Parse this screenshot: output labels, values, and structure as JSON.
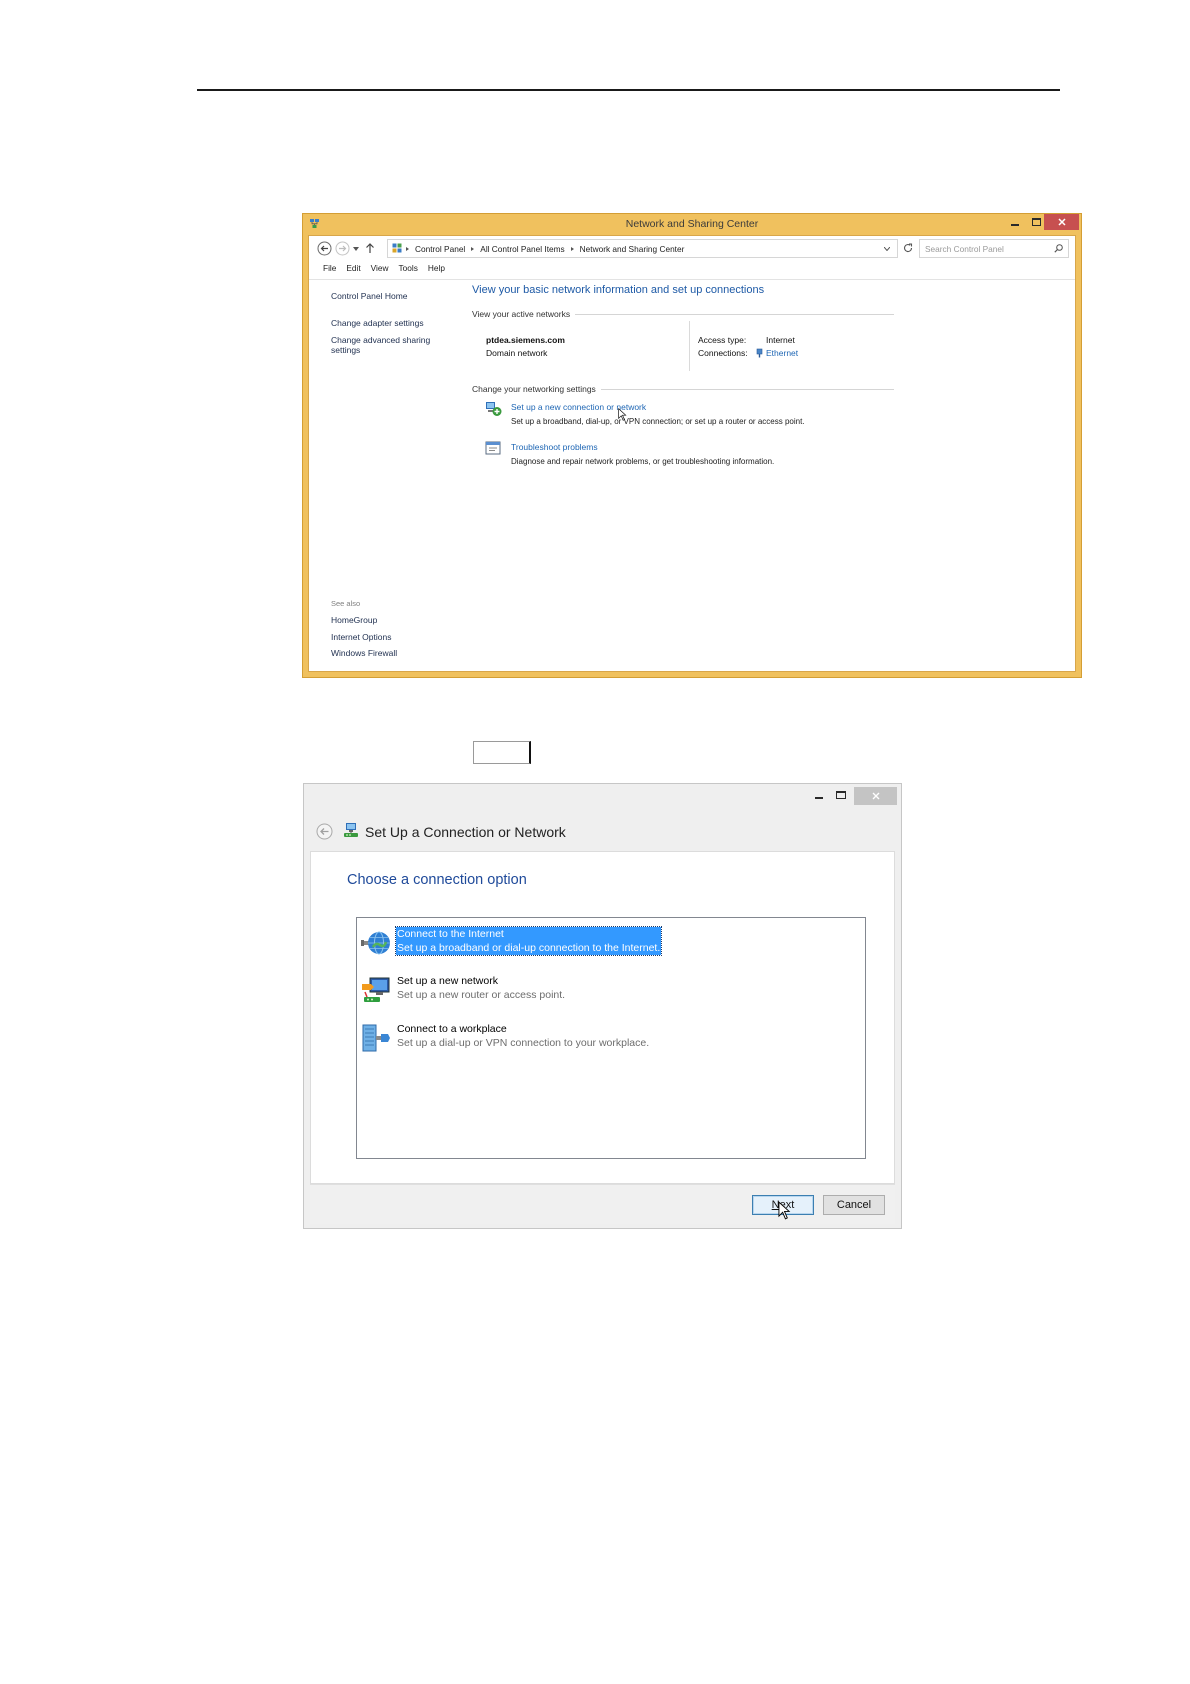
{
  "colors": {
    "window_frame": "#F0C15E",
    "close_button": "#C75050",
    "link": "#1E66B4",
    "heading": "#1E5AA6",
    "selection": "#3399FF",
    "dialog_heading": "#1F4A9A",
    "focus_border": "#3C7FB1"
  },
  "network_window": {
    "title": "Network and Sharing Center",
    "breadcrumb": [
      "Control Panel",
      "All Control Panel Items",
      "Network and Sharing Center"
    ],
    "search_placeholder": "Search Control Panel",
    "menu": [
      "File",
      "Edit",
      "View",
      "Tools",
      "Help"
    ],
    "left_pane": {
      "links": [
        "Control Panel Home",
        "Change adapter settings",
        "Change advanced sharing settings"
      ],
      "see_also_label": "See also",
      "see_also": [
        "HomeGroup",
        "Internet Options",
        "Windows Firewall"
      ]
    },
    "heading": "View your basic network information and set up connections",
    "active_networks": {
      "section_label": "View your active networks",
      "name": "ptdea.siemens.com",
      "type": "Domain network",
      "access_type_label": "Access type:",
      "access_type": "Internet",
      "connections_label": "Connections:",
      "connection": "Ethernet"
    },
    "settings": {
      "section_label": "Change your networking settings",
      "tasks": [
        {
          "icon": "new-connection-icon",
          "link": "Set up a new connection or network",
          "description": "Set up a broadband, dial-up, or VPN connection; or set up a router or access point."
        },
        {
          "icon": "troubleshoot-icon",
          "link": "Troubleshoot problems",
          "description": "Diagnose and repair network problems, or get troubleshooting information."
        }
      ]
    }
  },
  "setup_dialog": {
    "title": "Set Up a Connection or Network",
    "heading": "Choose a connection option",
    "options": [
      {
        "icon": "internet-globe-icon",
        "title": "Connect to the Internet",
        "description": "Set up a broadband or dial-up connection to the Internet.",
        "selected": true
      },
      {
        "icon": "new-network-icon",
        "title": "Set up a new network",
        "description": "Set up a new router or access point.",
        "selected": false
      },
      {
        "icon": "workplace-icon",
        "title": "Connect to a workplace",
        "description": "Set up a dial-up or VPN connection to your workplace.",
        "selected": false
      }
    ],
    "next_label": "Next",
    "cancel_label": "Cancel"
  }
}
